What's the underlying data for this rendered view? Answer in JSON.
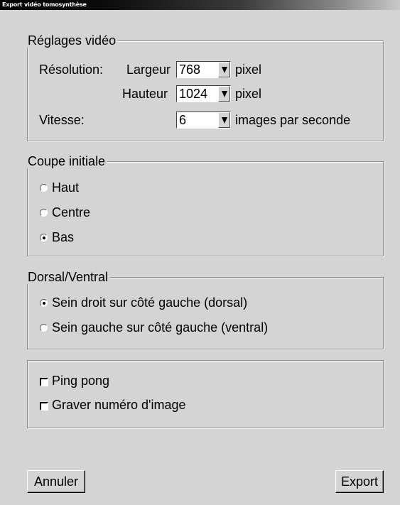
{
  "window": {
    "title": "Export vidéo tomosynthèse"
  },
  "video_settings": {
    "title": "Réglages vidéo",
    "resolution_label": "Résolution:",
    "width_label": "Largeur",
    "width_value": "768",
    "height_label": "Hauteur",
    "height_value": "1024",
    "pixel_unit": "pixel",
    "speed_label": "Vitesse:",
    "speed_value": "6",
    "speed_unit": "images par seconde"
  },
  "initial_slice": {
    "title": "Coupe initiale",
    "options": [
      {
        "label": "Haut",
        "selected": false
      },
      {
        "label": "Centre",
        "selected": false
      },
      {
        "label": "Bas",
        "selected": true
      }
    ]
  },
  "orientation": {
    "title": "Dorsal/Ventral",
    "options": [
      {
        "label": "Sein droit sur côté gauche (dorsal)",
        "selected": true
      },
      {
        "label": "Sein gauche sur côté gauche (ventral)",
        "selected": false
      }
    ]
  },
  "options": {
    "ping_pong": {
      "label": "Ping pong",
      "checked": false
    },
    "burn_frame_number": {
      "label": "Graver numéro d'image",
      "checked": false
    }
  },
  "buttons": {
    "cancel": "Annuler",
    "export": "Export"
  }
}
